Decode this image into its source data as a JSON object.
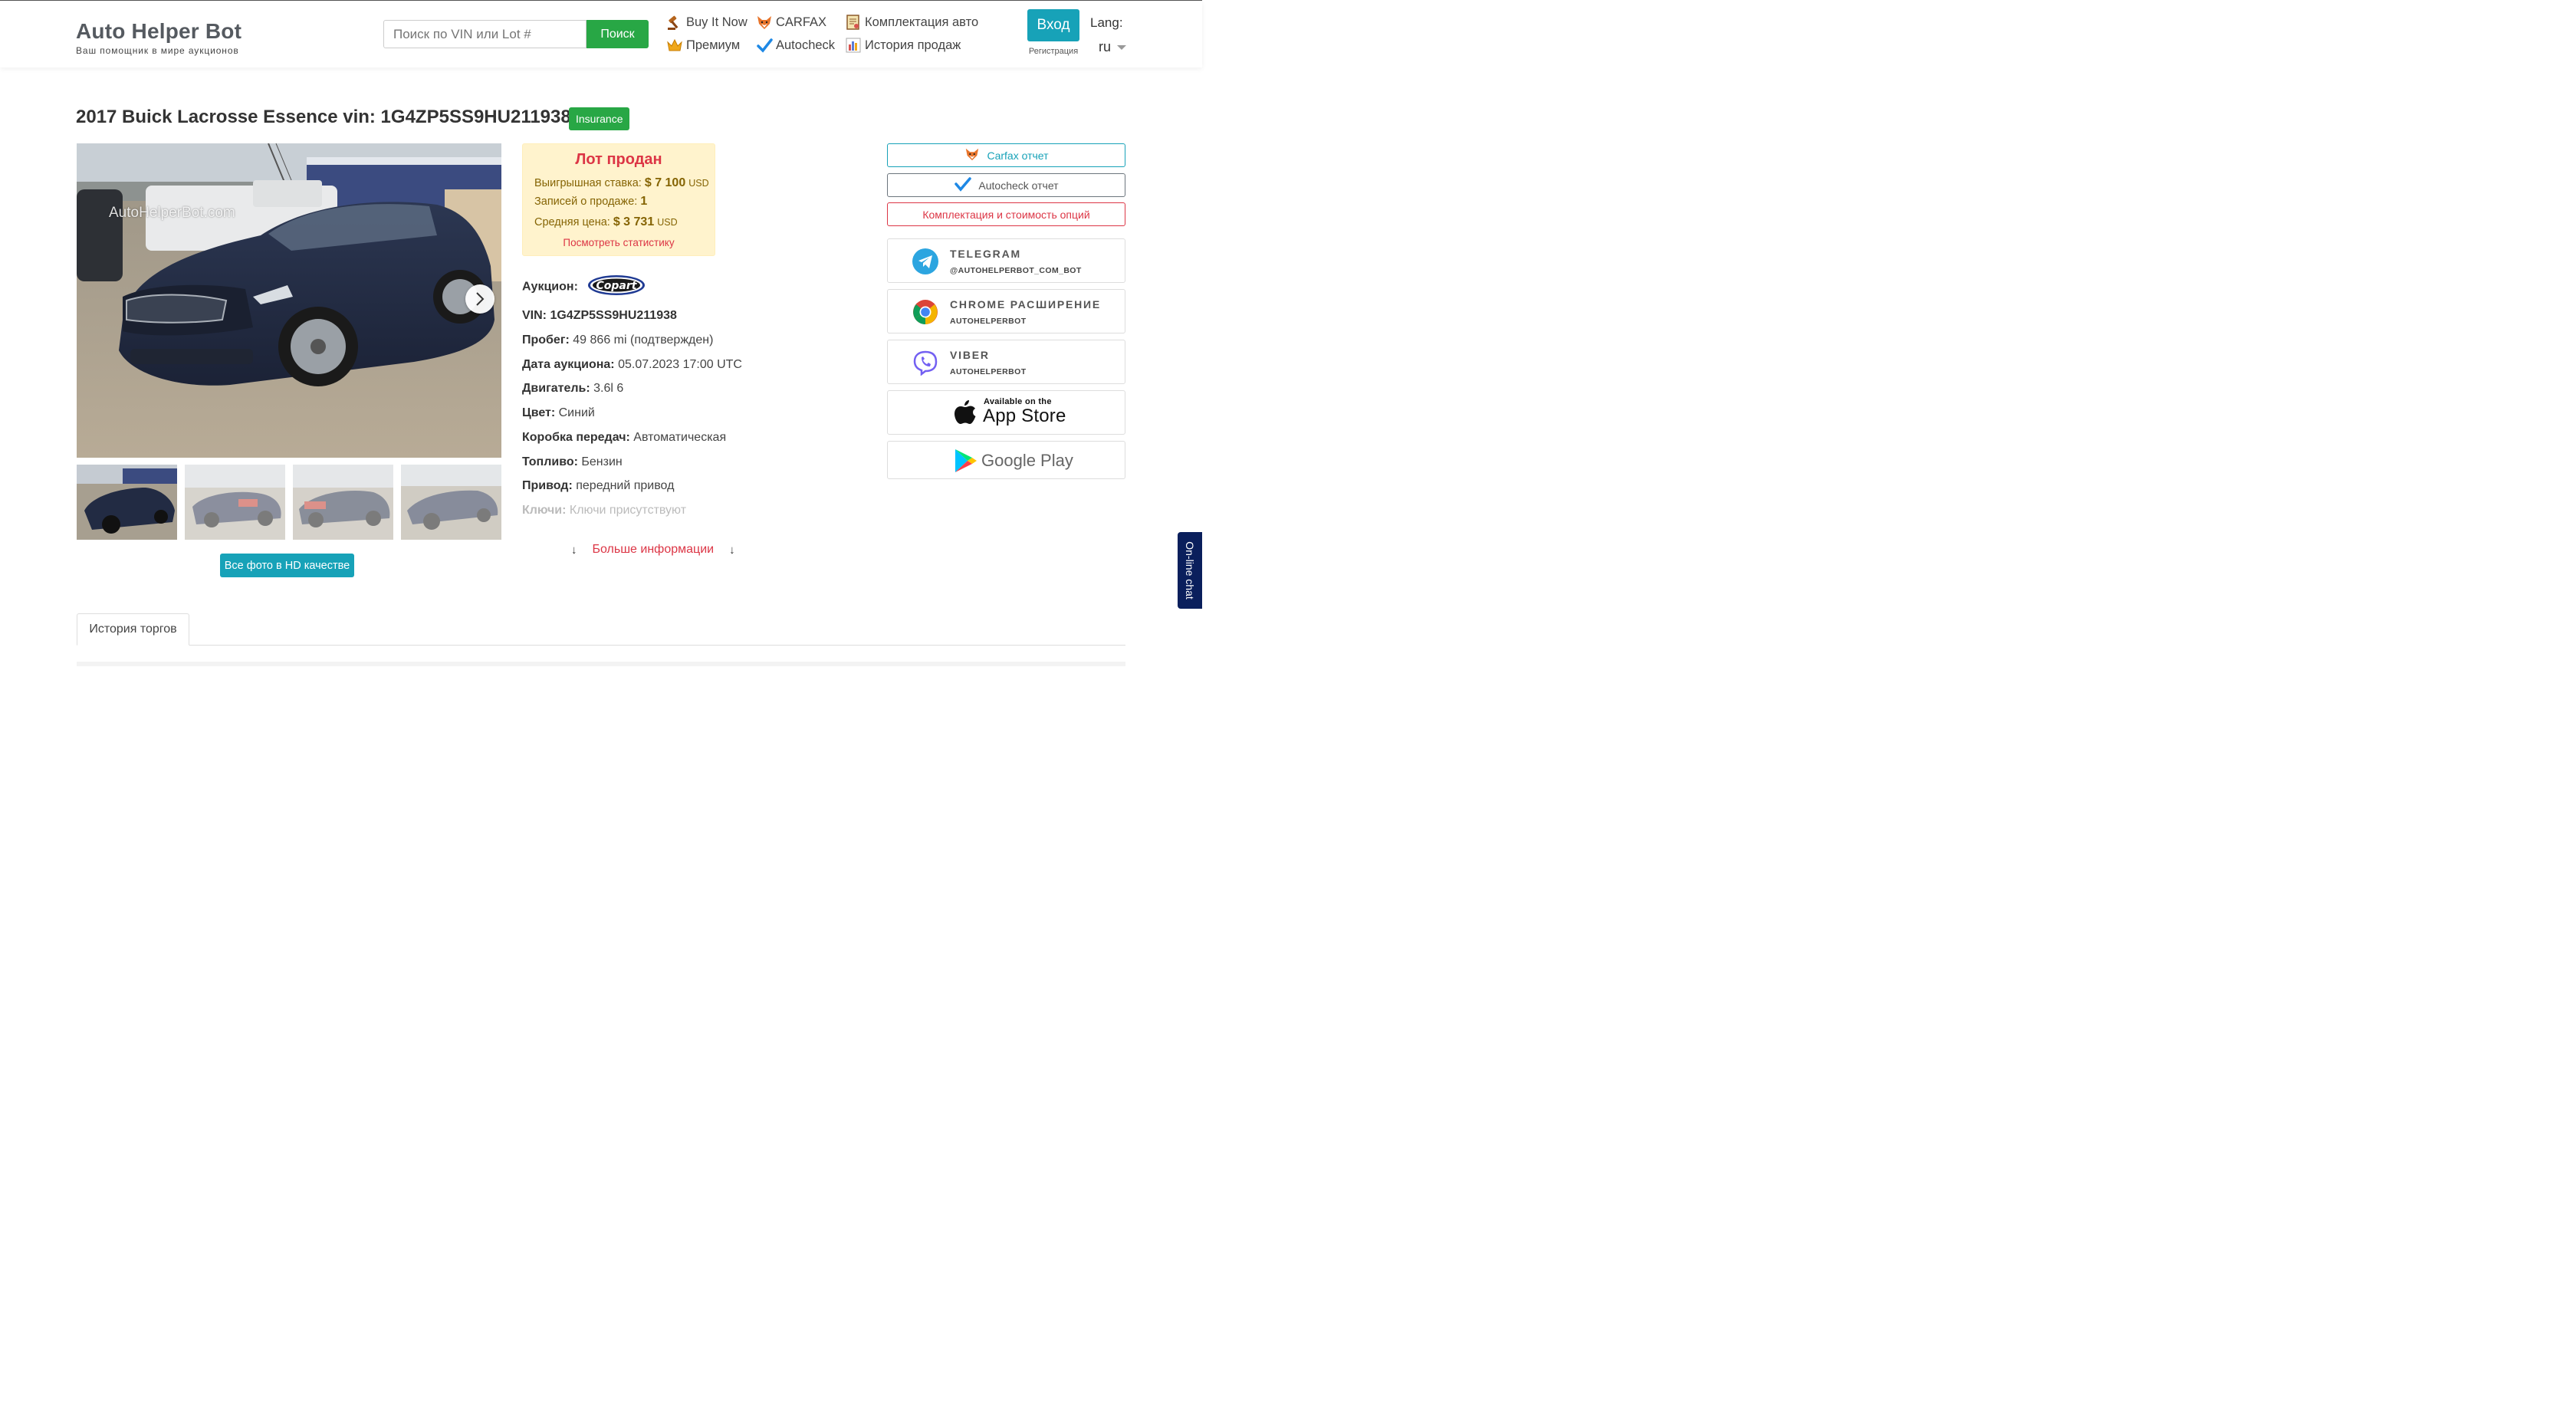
{
  "header": {
    "brand_name": "Auto Helper Bot",
    "brand_tagline": "Ваш помощник в мире аукционов",
    "search_placeholder": "Поиск по VIN или Lot #",
    "search_button": "Поиск",
    "nav": {
      "buy_it_now": "Buy It Now",
      "carfax": "CARFAX",
      "equipment": "Комплектация авто",
      "premium": "Премиум",
      "autocheck": "Autocheck",
      "sales_history": "История продаж"
    },
    "login_button": "Вход",
    "register_link": "Регистрация",
    "lang_label": "Lang:",
    "lang_value": "ru"
  },
  "lot": {
    "title": "2017 Buick Lacrosse Essence vin: 1G4ZP5SS9HU211938",
    "badge": "Insurance",
    "watermark": "AutoHelperBot.com",
    "hd_photos_button": "Все фото в HD качестве"
  },
  "sold": {
    "title": "Лот продан",
    "winning_bid_label": "Выигрышная ставка:",
    "winning_bid_value": "$ 7 100",
    "winning_bid_currency": "USD",
    "sales_records_label": "Записей о продаже:",
    "sales_records_value": "1",
    "avg_price_label": "Средняя цена:",
    "avg_price_value": "$ 3 731",
    "avg_price_currency": "USD",
    "stats_link": "Посмотреть статистику"
  },
  "details": {
    "auction_label": "Аукцион:",
    "auction_logo_text": "Copart",
    "vin_label": "VIN:",
    "vin_value": "1G4ZP5SS9HU211938",
    "mileage_label": "Пробег:",
    "mileage_value": "49 866 mi (подтвержден)",
    "date_label": "Дата аукциона:",
    "date_value": "05.07.2023 17:00 UTC",
    "engine_label": "Двигатель:",
    "engine_value": "3.6l 6",
    "color_label": "Цвет:",
    "color_value": "Синий",
    "transmission_label": "Коробка передач:",
    "transmission_value": "Автоматическая",
    "fuel_label": "Топливо:",
    "fuel_value": "Бензин",
    "drive_label": "Привод:",
    "drive_value": "передний привод",
    "keys_label": "Ключи:",
    "keys_value": "Ключи присутствуют",
    "more_info": "Больше информации"
  },
  "sidebar": {
    "carfax_report": "Carfax отчет",
    "autocheck_report": "Autocheck отчет",
    "options_cost": "Комплектация и стоимость опций",
    "telegram_name": "TELEGRAM",
    "telegram_handle": "@AUTOHELPERBOT_COM_BOT",
    "chrome_name": "CHROME РАСШИРЕНИЕ",
    "chrome_handle": "AUTOHELPERBOT",
    "viber_name": "VIBER",
    "viber_handle": "AUTOHELPERBOT",
    "appstore_small": "Available on the",
    "appstore_big": "App Store",
    "googleplay": "Google Play"
  },
  "tabs": {
    "history": "История торгов"
  },
  "chat": {
    "label": "On-line chat"
  },
  "colors": {
    "green": "#28a745",
    "teal": "#17a2b8",
    "red": "#dc3545",
    "sold_bg": "#fff3cd",
    "chat_bg": "#0a1f5c"
  }
}
